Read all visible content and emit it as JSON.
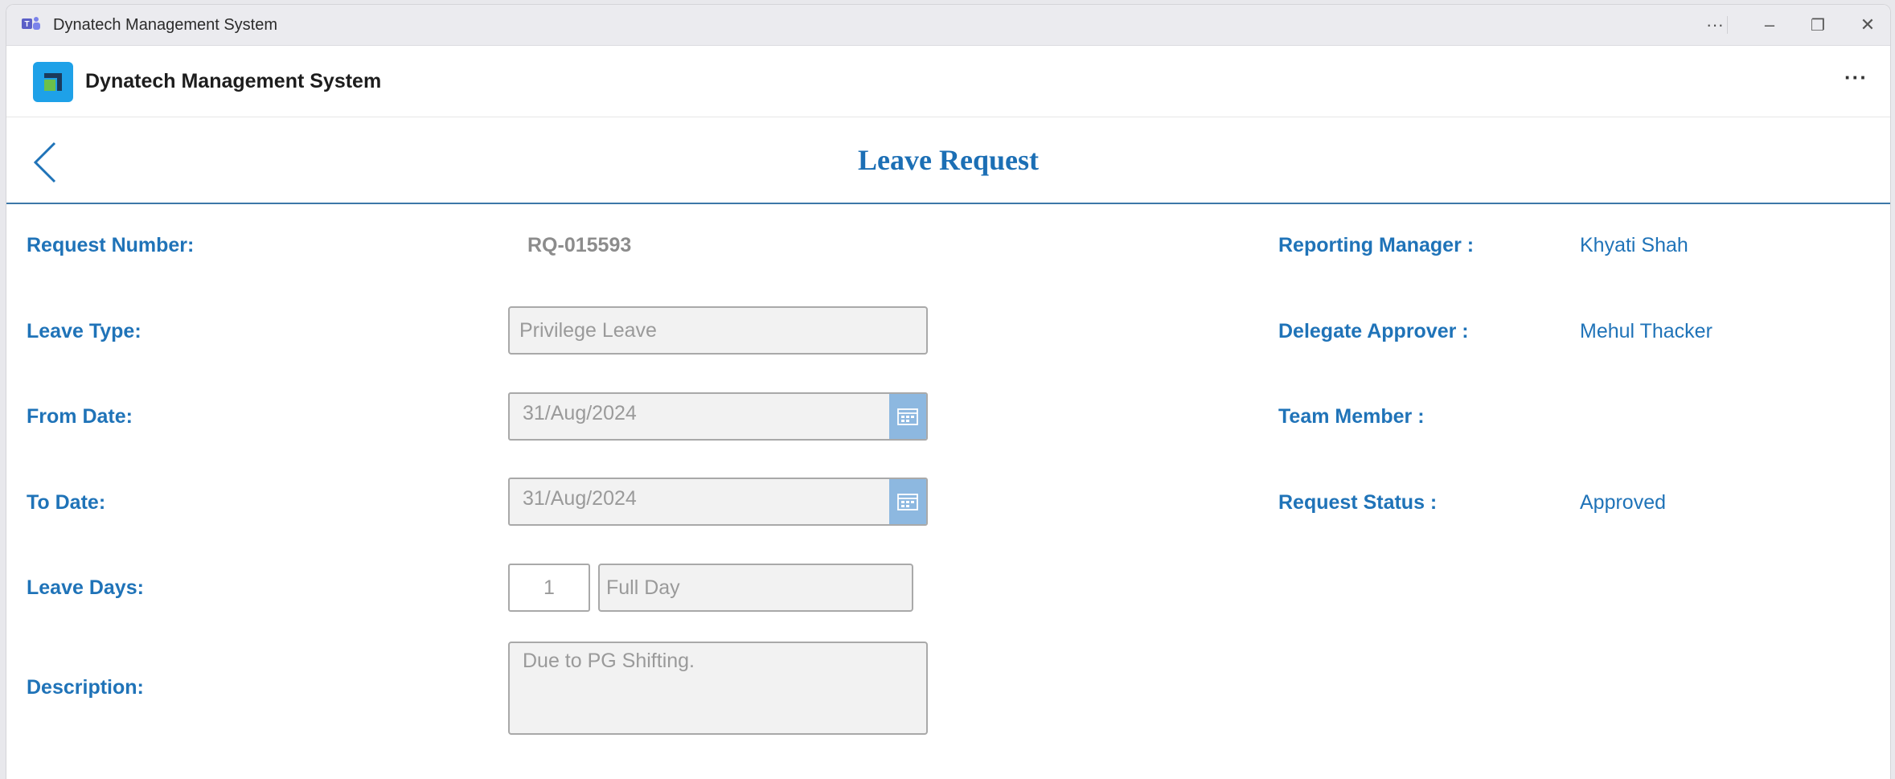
{
  "window": {
    "title": "Dynatech Management System",
    "controls": {
      "more": "···",
      "minimize": "–",
      "restore": "❐",
      "close": "✕"
    }
  },
  "app": {
    "name": "Dynatech Management System",
    "more": "···",
    "colors": {
      "accent": "#1f73b8",
      "logo_bg": "#1ea1e8",
      "logo_green": "#6cc04a",
      "logo_dark": "#1b3a5c"
    }
  },
  "page": {
    "title": "Leave Request",
    "back_icon": "chevron-left-icon"
  },
  "form": {
    "request_number": {
      "label": "Request Number:",
      "value": "RQ-015593"
    },
    "leave_type": {
      "label": "Leave Type:",
      "value": "Privilege Leave"
    },
    "from_date": {
      "label": "From Date:",
      "value": "31/Aug/2024",
      "icon": "calendar-icon"
    },
    "to_date": {
      "label": "To Date:",
      "value": "31/Aug/2024",
      "icon": "calendar-icon"
    },
    "leave_days": {
      "label": "Leave Days:",
      "count": "1",
      "duration": "Full Day"
    },
    "description": {
      "label": "Description:",
      "value": "Due to PG Shifting."
    }
  },
  "details": {
    "reporting_manager": {
      "label": "Reporting Manager :",
      "value": "Khyati Shah"
    },
    "delegate_approver": {
      "label": "Delegate Approver :",
      "value": "Mehul Thacker"
    },
    "team_member": {
      "label": "Team Member :",
      "value": ""
    },
    "request_status": {
      "label": "Request Status :",
      "value": "Approved"
    }
  }
}
